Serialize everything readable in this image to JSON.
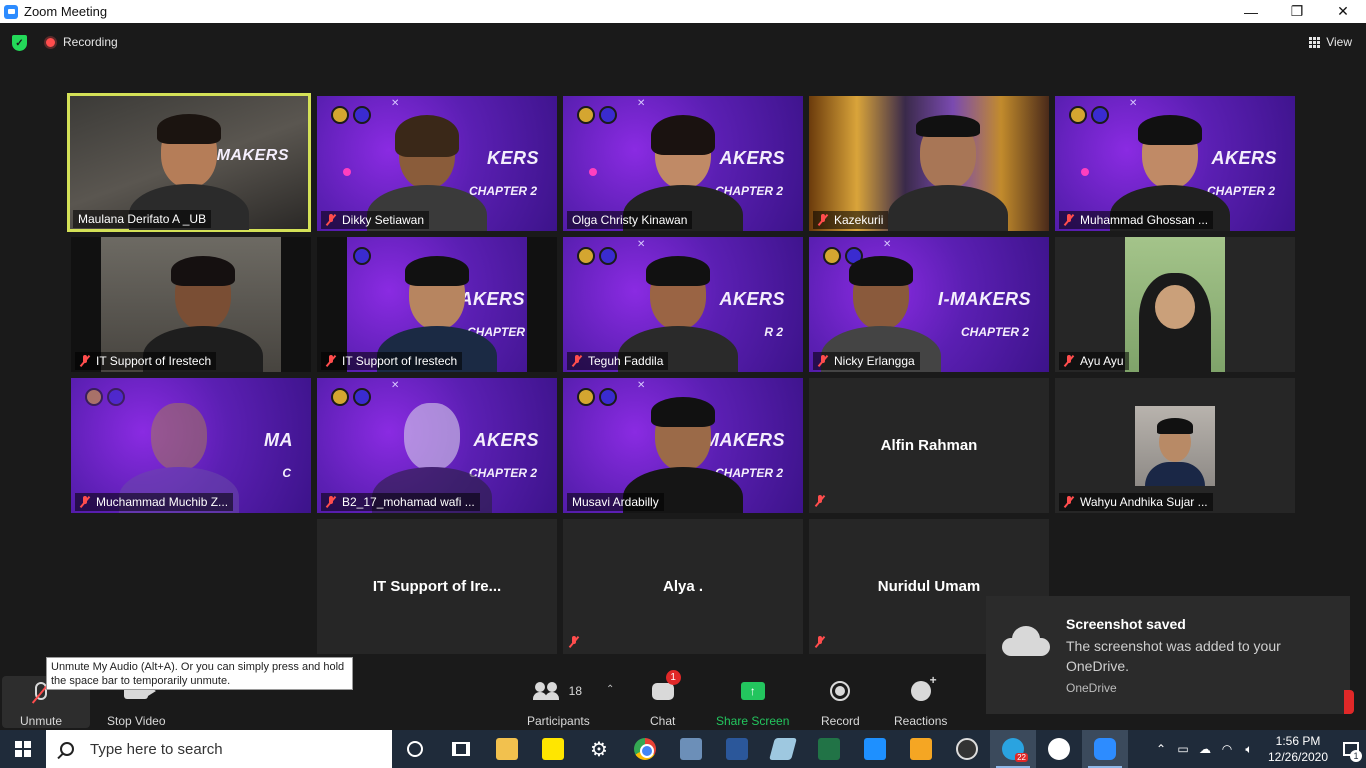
{
  "window": {
    "title": "Zoom Meeting",
    "minimize": "—",
    "maximize": "❐",
    "close": "✕"
  },
  "meeting_bar": {
    "recording_label": "Recording",
    "view_label": "View"
  },
  "tiles": [
    {
      "name": "Maulana Derifato A _UB",
      "muted": false,
      "active": true
    },
    {
      "name": "Dikky Setiawan",
      "muted": true
    },
    {
      "name": "Olga Christy Kinawan",
      "muted": false
    },
    {
      "name": "Kazekurii",
      "muted": true
    },
    {
      "name": "Muhammad Ghossan ...",
      "muted": true
    },
    {
      "name": "IT Support of Irestech",
      "muted": true
    },
    {
      "name": "IT Support of Irestech",
      "muted": true
    },
    {
      "name": "Teguh Faddila",
      "muted": true
    },
    {
      "name": "Nicky Erlangga",
      "muted": true
    },
    {
      "name": "Ayu Ayu",
      "muted": true
    },
    {
      "name": "Muchammad Muchib Z...",
      "muted": true
    },
    {
      "name": "B2_17_mohamad wafi ...",
      "muted": true
    },
    {
      "name": "Musavi Ardabilly",
      "muted": false
    },
    {
      "name": "Alfin Rahman",
      "muted": true,
      "video_off": true
    },
    {
      "name": "Wahyu Andhika Sujar ...",
      "muted": true
    },
    {
      "name": "IT Support of Ire...",
      "muted": false,
      "video_off": true
    },
    {
      "name": "Alya .",
      "muted": true,
      "video_off": true
    },
    {
      "name": "Nuridul Umam",
      "muted": true,
      "video_off": true
    }
  ],
  "toolbar": {
    "unmute_label": "Unmute",
    "stop_video_label": "Stop Video",
    "participants_label": "Participants",
    "participants_count": "18",
    "chat_label": "Chat",
    "chat_badge": "1",
    "share_label": "Share Screen",
    "record_label": "Record",
    "reactions_label": "Reactions"
  },
  "tooltip": {
    "text": "Unmute My Audio (Alt+A). Or you can simply press and hold the space bar to temporarily unmute."
  },
  "toast": {
    "title": "Screenshot saved",
    "body": "The screenshot was added to your OneDrive.",
    "source": "OneDrive"
  },
  "taskbar": {
    "search_placeholder": "Type here to search",
    "telegram_badge": "22",
    "time": "1:56 PM",
    "date": "12/26/2020",
    "notification_count": "1"
  },
  "colors": {
    "active_speaker_border": "#d4e157",
    "share_green": "#23c55e",
    "mute_red": "#ff4d4d",
    "recording_red": "#ff4d4d"
  }
}
